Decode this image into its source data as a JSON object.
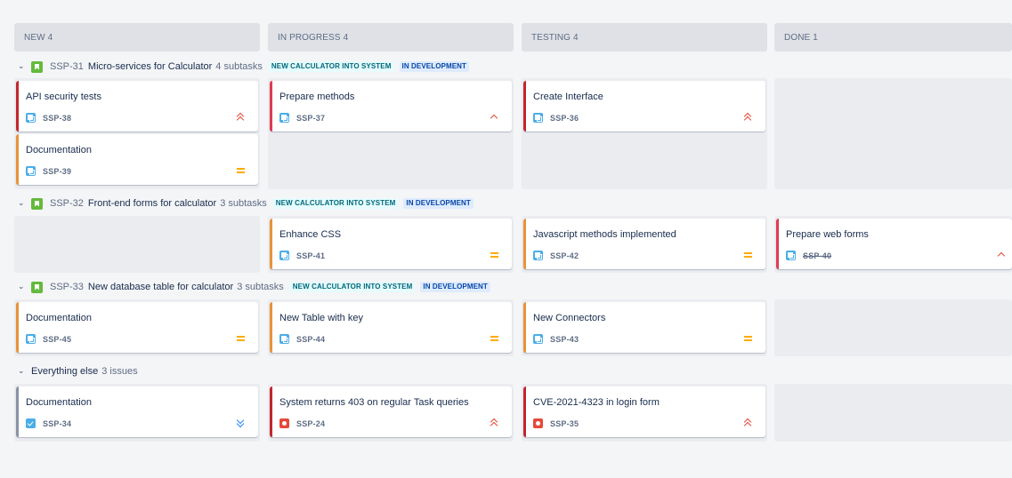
{
  "columns": [
    {
      "name": "NEW",
      "count": "4"
    },
    {
      "name": "IN PROGRESS",
      "count": "4"
    },
    {
      "name": "TESTING",
      "count": "4"
    },
    {
      "name": "DONE",
      "count": "1"
    }
  ],
  "swimlanes": [
    {
      "key": "SSP-31",
      "title": "Micro-services for Calculator",
      "subtasks": "4 subtasks",
      "labels": [
        "NEW CALCULATOR INTO SYSTEM",
        "IN DEVELOPMENT"
      ]
    },
    {
      "key": "SSP-32",
      "title": "Front-end forms for calculator",
      "subtasks": "3 subtasks",
      "labels": [
        "NEW CALCULATOR INTO SYSTEM",
        "IN DEVELOPMENT"
      ]
    },
    {
      "key": "SSP-33",
      "title": "New database table for calculator",
      "subtasks": "3 subtasks",
      "labels": [
        "NEW CALCULATOR INTO SYSTEM",
        "IN DEVELOPMENT"
      ]
    },
    {
      "title": "Everything else",
      "subtasks": "3 issues"
    }
  ],
  "cards": {
    "api_security": {
      "title": "API security tests",
      "key": "SSP-38",
      "icon": "subtask-icon",
      "priority": "highest"
    },
    "documentation_39": {
      "title": "Documentation",
      "key": "SSP-39",
      "icon": "subtask-icon",
      "priority": "medium"
    },
    "prepare_methods": {
      "title": "Prepare methods",
      "key": "SSP-37",
      "icon": "subtask-icon",
      "priority": "high"
    },
    "create_interface": {
      "title": "Create Interface",
      "key": "SSP-36",
      "icon": "subtask-icon",
      "priority": "highest"
    },
    "enhance_css": {
      "title": "Enhance CSS",
      "key": "SSP-41",
      "icon": "subtask-icon",
      "priority": "medium"
    },
    "js_methods": {
      "title": "Javascript methods implemented",
      "key": "SSP-42",
      "icon": "subtask-icon",
      "priority": "medium"
    },
    "web_forms": {
      "title": "Prepare web forms",
      "key": "SSP-40",
      "icon": "subtask-icon",
      "priority": "high"
    },
    "documentation_45": {
      "title": "Documentation",
      "key": "SSP-45",
      "icon": "subtask-icon",
      "priority": "medium"
    },
    "new_table": {
      "title": "New Table with key",
      "key": "SSP-44",
      "icon": "subtask-icon",
      "priority": "medium"
    },
    "new_connectors": {
      "title": "New Connectors",
      "key": "SSP-43",
      "icon": "subtask-icon",
      "priority": "medium"
    },
    "documentation_34": {
      "title": "Documentation",
      "key": "SSP-34",
      "icon": "task-icon",
      "priority": "lowest"
    },
    "system_403": {
      "title": "System returns 403 on regular Task queries",
      "key": "SSP-24",
      "icon": "bug-icon",
      "priority": "highest"
    },
    "cve": {
      "title": "CVE-2021-4323 in login form",
      "key": "SSP-35",
      "icon": "bug-icon",
      "priority": "highest"
    }
  },
  "colors": {
    "story": "#63ba3c",
    "subtask": "#4bade8",
    "bug": "#e5493a",
    "priority_high": "#e5493a",
    "priority_medium": "#ffab00",
    "priority_low": "#2684ff"
  }
}
